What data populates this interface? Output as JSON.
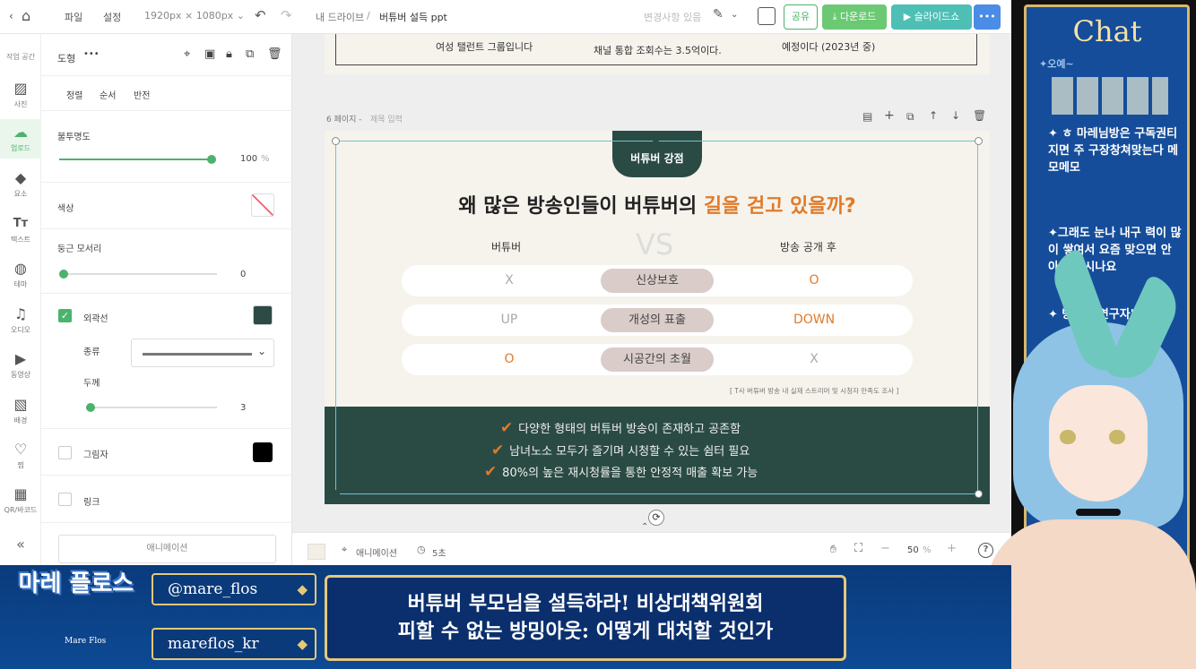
{
  "topbar": {
    "menu_file": "파일",
    "menu_settings": "설정",
    "size": "1920px × 1080px",
    "breadcrumb_root": "내 드라이브",
    "breadcrumb_sep": "/",
    "doc_title": "버튜버 설득 ppt",
    "save_status": "변경사항 있음",
    "share": "공유",
    "download": "다운로드",
    "slideshow": "슬라이드쇼"
  },
  "sidebar": {
    "items": [
      {
        "label": "작업 공간",
        "icon": "☰"
      },
      {
        "label": "사진",
        "icon": "▨"
      },
      {
        "label": "업로드",
        "icon": "☁"
      },
      {
        "label": "요소",
        "icon": "◆"
      },
      {
        "label": "텍스트",
        "icon": "Tт"
      },
      {
        "label": "테마",
        "icon": "◍"
      },
      {
        "label": "오디오",
        "icon": "♫"
      },
      {
        "label": "동영상",
        "icon": "▶"
      },
      {
        "label": "배경",
        "icon": "▧"
      },
      {
        "label": "찜",
        "icon": "♡"
      },
      {
        "label": "QR/바코드",
        "icon": "▦"
      }
    ],
    "collapse": "«"
  },
  "panel": {
    "title": "도형",
    "more": "•••",
    "tabs": [
      "정렬",
      "순서",
      "반전"
    ],
    "opacity_label": "불투명도",
    "opacity_value": "100",
    "opacity_unit": "%",
    "color_label": "색상",
    "radius_label": "둥근 모서리",
    "radius_value": "0",
    "outline_label": "외곽선",
    "type_label": "종류",
    "thickness_label": "두께",
    "thickness_value": "3",
    "shadow_label": "그림자",
    "link_label": "링크",
    "animation_button": "애니메이션",
    "outline_color": "#2d4a45",
    "shadow_color": "#000000"
  },
  "canvas": {
    "slide5_texts": [
      "여성 탤런트 그룹입니다",
      "채널 통합 조회수는 3.5억이다.",
      "예정이다 (2023년 중)"
    ],
    "page_label": "6 페이지 -",
    "page_title_placeholder": "제목 입력",
    "badge": "버튜버 강점",
    "heading_main": "왜 많은 방송인들이 버튜버의 ",
    "heading_accent": "길을 걷고 있을까?",
    "col_left": "버튜버",
    "vs": "VS",
    "col_right": "방송 공개 후",
    "rows": [
      {
        "left": "X",
        "middle": "신상보호",
        "right": "O"
      },
      {
        "left": "UP",
        "middle": "개성의 표출",
        "right": "DOWN"
      },
      {
        "left": "O",
        "middle": "시공간의 초월",
        "right": "X"
      }
    ],
    "source": "[ T사 버튜버 방송 내 실제 스트리머 및 시청자 만족도 조사 ]",
    "checks": [
      "다양한 형태의 버튜버 방송이 존재하고 공존함",
      "남녀노소 모두가 즐기며 시청할 수 있는 쉼터 필요",
      "80%의 높은 재시청률을 통한 안정적 매출 확보 가능"
    ],
    "accent_color": "#e07b2a",
    "dark_color": "#2a4b43"
  },
  "status": {
    "animation": "애니메이션",
    "duration": "5초",
    "zoom": "50",
    "zoom_unit": "%",
    "help": "?"
  },
  "stream": {
    "chat_title": "Chat",
    "chat_lines": [
      "✦오예~",
      "✦ ㅎ 마레님방은 구독권티지면 주 구장창쳐맞는다 메모메모",
      "✦그래도 눈나 내구 력이 많이 쌓여서 요즘 맞으면 안 아 파지시나요",
      "✦ 방밍의 연구자'"
    ],
    "handle_twitter": "@mare_flos",
    "handle_twitch": "mareflos_kr",
    "banner_line1": "버튜버 부모님을 설득하라! 비상대책위원회",
    "banner_line2": "피할 수 없는 방밍아웃: 어떻게 대처할 것인가",
    "logo_text": "마레 플로스",
    "logo_sub": "Mare Flos"
  }
}
